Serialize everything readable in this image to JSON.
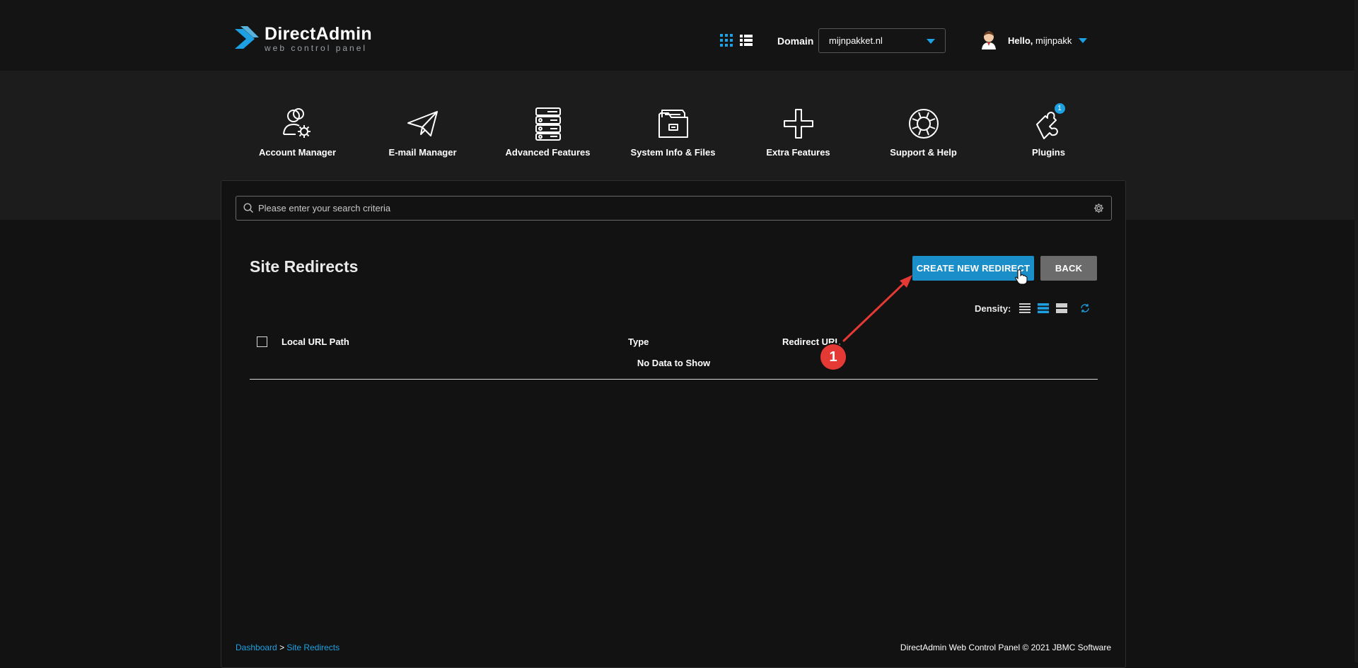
{
  "header": {
    "logo_name": "DirectAdmin",
    "logo_sub": "web control panel",
    "domain_label": "Domain",
    "domain_value": "mijnpakket.nl",
    "greeting": "Hello,",
    "username": "mijnpakk"
  },
  "nav": {
    "items": [
      {
        "label": "Account Manager",
        "icon": "account-manager-icon"
      },
      {
        "label": "E-mail Manager",
        "icon": "paper-plane-icon"
      },
      {
        "label": "Advanced Features",
        "icon": "server-icon"
      },
      {
        "label": "System Info & Files",
        "icon": "folder-icon"
      },
      {
        "label": "Extra Features",
        "icon": "plus-icon"
      },
      {
        "label": "Support & Help",
        "icon": "lifebuoy-icon"
      },
      {
        "label": "Plugins",
        "icon": "puzzle-icon"
      }
    ],
    "plugins_badge": "1"
  },
  "search": {
    "placeholder": "Please enter your search criteria"
  },
  "page": {
    "title": "Site Redirects",
    "create_button": "CREATE NEW REDIRECT",
    "back_button": "BACK",
    "density_label": "Density:"
  },
  "table": {
    "columns": [
      "Local URL Path",
      "Type",
      "Redirect URL"
    ],
    "empty_text": "No Data to Show"
  },
  "footer": {
    "breadcrumb": [
      "Dashboard",
      "Site Redirects"
    ],
    "breadcrumb_sep": ">",
    "copyright": "DirectAdmin Web Control Panel © 2021 JBMC Software"
  },
  "annotation": {
    "number": "1"
  },
  "colors": {
    "accent": "#1da1e2",
    "create_button": "#1a8ec8",
    "back_button": "#6b6b6b",
    "annotation": "#e53935"
  }
}
